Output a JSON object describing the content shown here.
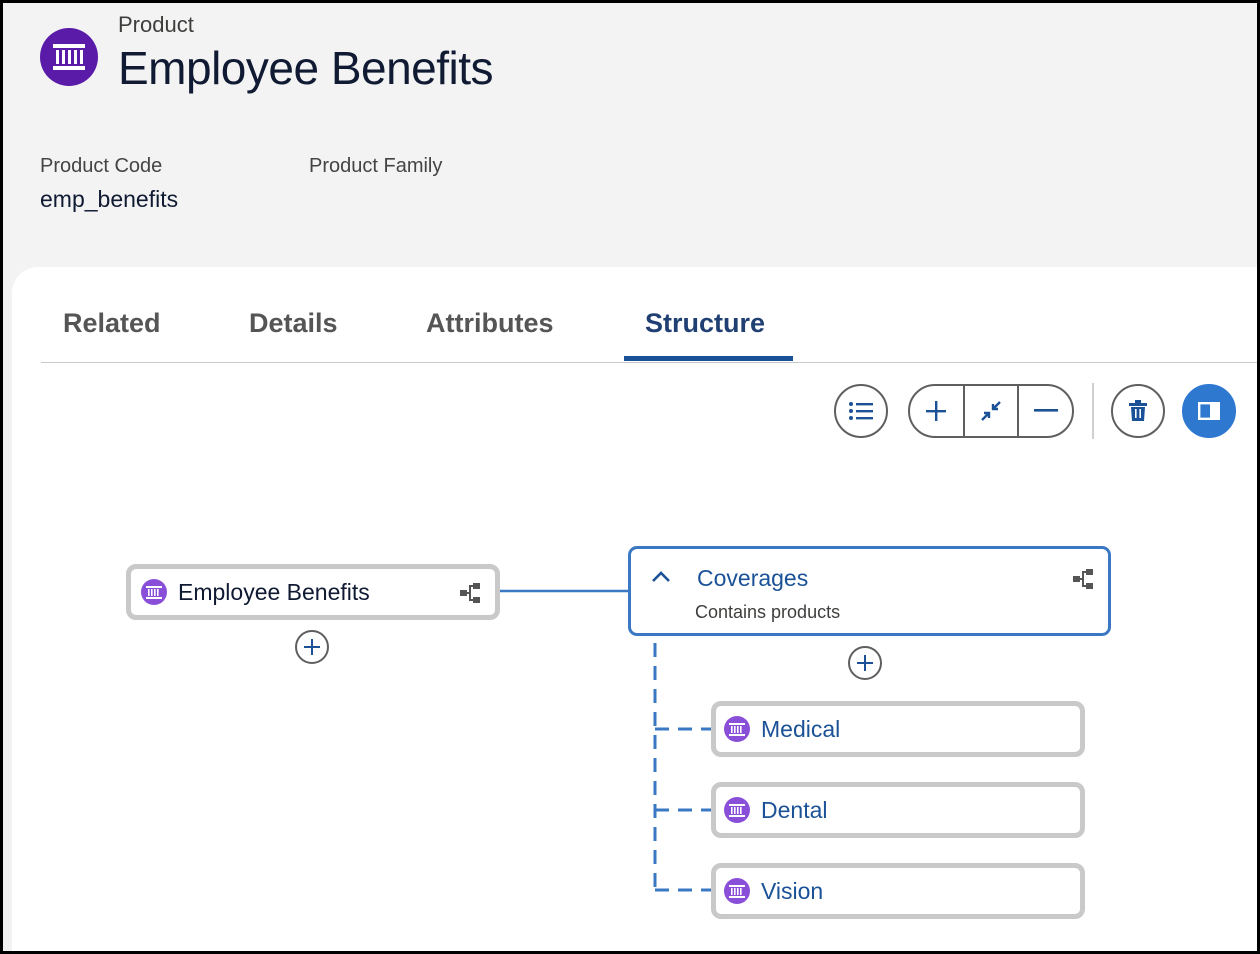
{
  "header": {
    "object_type": "Product",
    "title": "Employee Benefits",
    "icon": "product-icon"
  },
  "fields": [
    {
      "label": "Product Code",
      "value": "emp_benefits"
    },
    {
      "label": "Product Family",
      "value": ""
    }
  ],
  "tabs": [
    {
      "label": "Related",
      "active": false
    },
    {
      "label": "Details",
      "active": false
    },
    {
      "label": "Attributes",
      "active": false
    },
    {
      "label": "Structure",
      "active": true
    }
  ],
  "toolbar": {
    "buttons": [
      "list-view-icon",
      "expand-all-icon",
      "collapse-icon",
      "zoom-out-icon",
      "delete-icon",
      "panel-toggle-icon"
    ]
  },
  "structure": {
    "root": {
      "label": "Employee Benefits",
      "icon": "product-icon"
    },
    "group": {
      "label": "Coverages",
      "subtitle": "Contains products",
      "expanded": true
    },
    "children": [
      {
        "label": "Medical",
        "icon": "product-icon"
      },
      {
        "label": "Dental",
        "icon": "product-icon"
      },
      {
        "label": "Vision",
        "icon": "product-icon"
      }
    ]
  },
  "colors": {
    "brand_purple": "#5a1ba9",
    "node_purple": "#8a4fd8",
    "link_blue": "#1b5297",
    "accent_blue": "#2e78d0",
    "connector_blue": "#3a78c3"
  }
}
